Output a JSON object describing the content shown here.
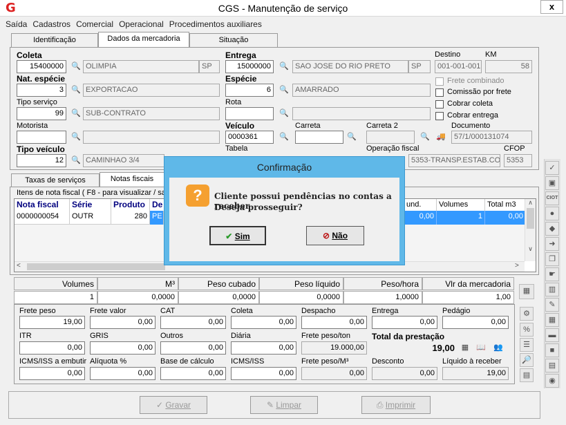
{
  "window": {
    "title": "CGS - Manutenção de serviço",
    "logo": "G",
    "close": "x"
  },
  "menu": [
    "Saída",
    "Cadastros",
    "Comercial",
    "Operacional",
    "Procedimentos auxiliares"
  ],
  "tabs": [
    "Identificação",
    "Dados da mercadoria",
    "Situação"
  ],
  "coleta": {
    "label": "Coleta",
    "code": "15400000",
    "city": "OLIMPIA",
    "uf": "SP"
  },
  "entrega": {
    "label": "Entrega",
    "code": "15000000",
    "city": "SAO JOSE DO RIO PRETO",
    "uf": "SP"
  },
  "destino": {
    "label": "Destino",
    "value": "001-001-001"
  },
  "km": {
    "label": "KM",
    "value": "58"
  },
  "nat": {
    "label": "Nat. espécie",
    "code": "3",
    "desc": "EXPORTACAO"
  },
  "especie": {
    "label": "Espécie",
    "code": "6",
    "desc": "AMARRADO"
  },
  "checks": {
    "frete_combinado": "Frete combinado",
    "comissao": "Comissão por frete",
    "cobrar_coleta": "Cobrar coleta",
    "cobrar_entrega": "Cobrar entrega"
  },
  "tipo_servico": {
    "label": "Tipo serviço",
    "code": "99",
    "desc": "SUB-CONTRATO"
  },
  "rota": {
    "label": "Rota"
  },
  "motorista": {
    "label": "Motorista"
  },
  "veiculo": {
    "label": "Veículo",
    "value": "0000361"
  },
  "carreta": {
    "label": "Carreta"
  },
  "carreta2": {
    "label": "Carreta 2"
  },
  "documento": {
    "label": "Documento",
    "value": "57/1/000131074"
  },
  "tipo_veiculo": {
    "label": "Tipo veículo",
    "code": "12",
    "desc": "CAMINHAO 3/4"
  },
  "tabela": {
    "label": "Tabela"
  },
  "operacao": {
    "label": "Operação fiscal",
    "value": "5353-TRANSP.ESTAB.CO"
  },
  "cfop": {
    "label": "CFOP",
    "value": "5353"
  },
  "lower_tabs": [
    "Taxas de serviços",
    "Notas fiscais"
  ],
  "nf_group": "Itens de nota fiscal ( F8 - para visualizar / sa",
  "grid": {
    "headers": [
      "Nota fiscal",
      "Série",
      "Produto",
      "De"
    ],
    "row": [
      "0000000054",
      "OUTR",
      "280",
      "PE"
    ],
    "right_headers": [
      "und.",
      "Volumes",
      "Total m3"
    ],
    "right_row": [
      "0,00",
      "1",
      "0,00"
    ]
  },
  "summary": {
    "headers": [
      "Volumes",
      "M³",
      "Peso cubado",
      "Peso líquido",
      "Peso/hora",
      "Vlr da mercadoria"
    ],
    "values": [
      "1",
      "0,0000",
      "0,0000",
      "0,0000",
      "1,0000",
      "1,00"
    ]
  },
  "charges": [
    {
      "label": "Frete peso",
      "value": "19,00"
    },
    {
      "label": "Frete valor",
      "value": "0,00"
    },
    {
      "label": "CAT",
      "value": "0,00"
    },
    {
      "label": "Coleta",
      "value": "0,00"
    },
    {
      "label": "Despacho",
      "value": "0,00"
    },
    {
      "label": "Entrega",
      "value": "0,00"
    },
    {
      "label": "Pedágio",
      "value": "0,00"
    },
    {
      "label": "ITR",
      "value": "0,00"
    },
    {
      "label": "GRIS",
      "value": "0,00"
    },
    {
      "label": "Outros",
      "value": "0,00"
    },
    {
      "label": "Diária",
      "value": "0,00"
    },
    {
      "label": "Frete peso/ton",
      "value": "19.000,00"
    },
    {
      "label": "ICMS/ISS a embutir",
      "value": "0,00"
    },
    {
      "label": "Alíquota %",
      "value": "0,00"
    },
    {
      "label": "Base de cálculo",
      "value": "0,00"
    },
    {
      "label": "ICMS/ISS",
      "value": "0,00"
    },
    {
      "label": "Frete peso/M³",
      "value": "0,00"
    },
    {
      "label": "Desconto",
      "value": "0,00"
    },
    {
      "label": "Líquido à receber",
      "value": "19,00"
    }
  ],
  "total": {
    "label": "Total da prestação",
    "value": "19,00"
  },
  "buttons": {
    "gravar": "Gravar",
    "limpar": "Limpar",
    "imprimir": "Imprimir"
  },
  "dialog": {
    "title": "Confirmação",
    "line1": "Cliente possui pendências no contas a receber",
    "line2": "Deseja prosseguir?",
    "yes": "Sim",
    "no": "Não",
    "icon": "?"
  },
  "colors": {
    "accent": "#5fb8e8",
    "warning": "#f5a030",
    "grid_header": "#00007f",
    "selection": "#3399ff"
  }
}
